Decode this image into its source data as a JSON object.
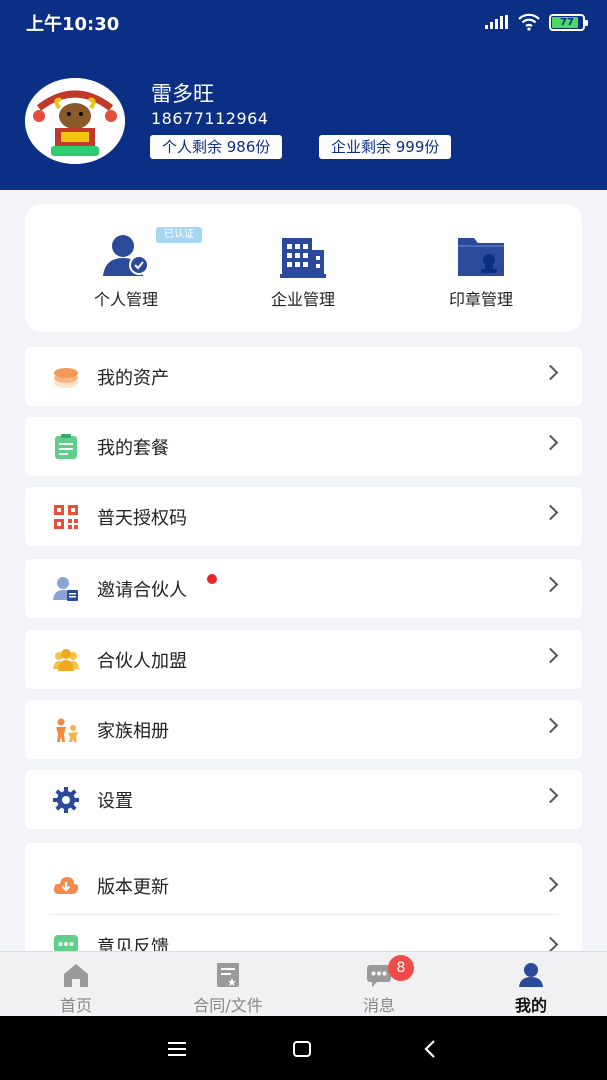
{
  "status_bar": {
    "time": "上午10:30",
    "battery": "77"
  },
  "profile": {
    "name": "雷多旺",
    "phone": "18677112964",
    "personal_quota": "个人剩余 986份",
    "enterprise_quota": "企业剩余 999份"
  },
  "management": [
    {
      "label": "个人管理",
      "badge": "已认证",
      "icon": "person-verified-icon"
    },
    {
      "label": "企业管理",
      "icon": "building-icon"
    },
    {
      "label": "印章管理",
      "icon": "seal-folder-icon"
    }
  ],
  "menu": [
    {
      "label": "我的资产",
      "icon": "coins-icon"
    },
    {
      "label": "我的套餐",
      "icon": "clipboard-icon"
    },
    {
      "label": "普天授权码",
      "icon": "qr-code-icon"
    },
    {
      "label": "邀请合伙人",
      "icon": "invite-partner-icon",
      "has_dot": true
    },
    {
      "label": "合伙人加盟",
      "icon": "partners-group-icon"
    },
    {
      "label": "家族相册",
      "icon": "family-icon"
    },
    {
      "label": "设置",
      "icon": "gear-icon"
    }
  ],
  "menu_group": [
    {
      "label": "版本更新",
      "icon": "cloud-download-icon"
    },
    {
      "label": "意见反馈",
      "icon": "feedback-chat-icon"
    }
  ],
  "tabs": [
    {
      "label": "首页",
      "icon": "home-icon",
      "active": false
    },
    {
      "label": "合同/文件",
      "icon": "contract-icon",
      "active": false
    },
    {
      "label": "消息",
      "icon": "message-icon",
      "active": false,
      "badge": "8"
    },
    {
      "label": "我的",
      "icon": "user-icon",
      "active": true
    }
  ],
  "colors": {
    "header_bg": "#0c2f86",
    "page_bg": "#f3f4f8",
    "accent_blue": "#2c4a9a",
    "badge_red": "#ee4b4b"
  }
}
